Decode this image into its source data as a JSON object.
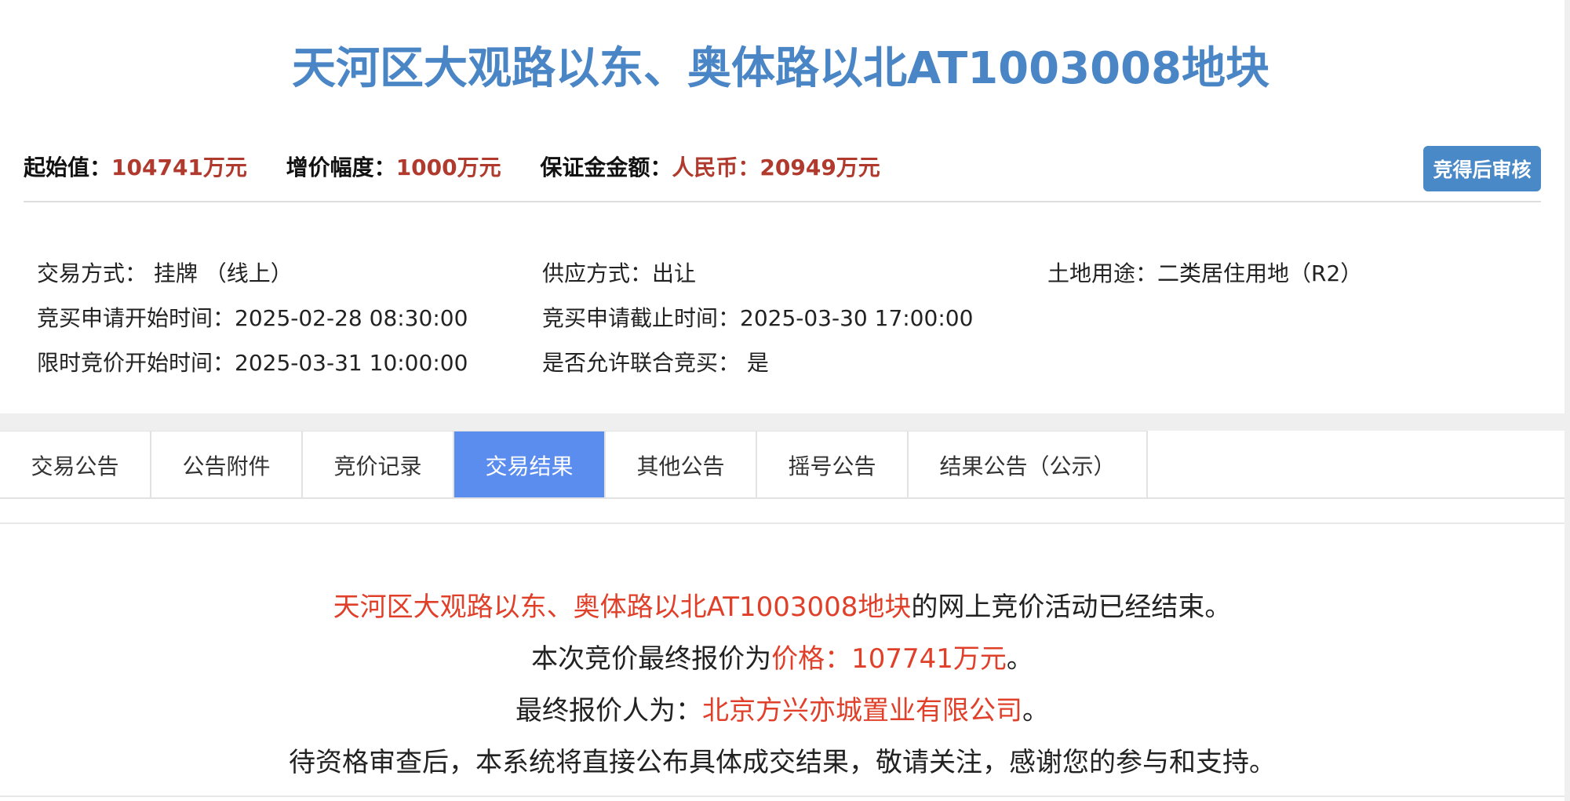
{
  "title": "天河区大观路以东、奥体路以北AT1003008地块",
  "summary": {
    "start_label": "起始值：",
    "start_value": "104741万元",
    "increment_label": "增价幅度：",
    "increment_value": "1000万元",
    "deposit_label": "保证金金额：",
    "deposit_value": "人民币：20949万元",
    "review_button": "竞得后审核"
  },
  "info": {
    "trade_method": "交易方式：   挂牌  （线上）",
    "supply_method": "供应方式：出让",
    "land_use": "土地用途：二类居住用地（R2）",
    "apply_start": "竞买申请开始时间：2025-02-28 08:30:00",
    "apply_end": "竞买申请截止时间：2025-03-30 17:00:00",
    "bid_start": "限时竞价开始时间：2025-03-31 10:00:00",
    "joint_bid": "是否允许联合竞买：  是"
  },
  "tabs": [
    {
      "label": "交易公告"
    },
    {
      "label": "公告附件"
    },
    {
      "label": "竞价记录"
    },
    {
      "label": "交易结果"
    },
    {
      "label": "其他公告"
    },
    {
      "label": "摇号公告"
    },
    {
      "label": "结果公告（公示）"
    }
  ],
  "active_tab": "交易结果",
  "result": {
    "line1_red": "天河区大观路以东、奥体路以北AT1003008地块",
    "line1_rest": "的网上竞价活动已经结束。",
    "line2_prefix": "本次竞价最终报价为",
    "line2_red": "价格：107741万元",
    "line2_suffix": "。",
    "line3_prefix": "最终报价人为：",
    "line3_red": "北京方兴亦城置业有限公司",
    "line3_suffix": "。",
    "line4": "待资格审查后，本系统将直接公布具体成交结果，敬请关注，感谢您的参与和支持。"
  },
  "colors": {
    "title": "#4a86c6",
    "value_red": "#b03a2e",
    "highlight_red": "#e0402a",
    "active_tab": "#5b8def",
    "button": "#4a89c7"
  }
}
